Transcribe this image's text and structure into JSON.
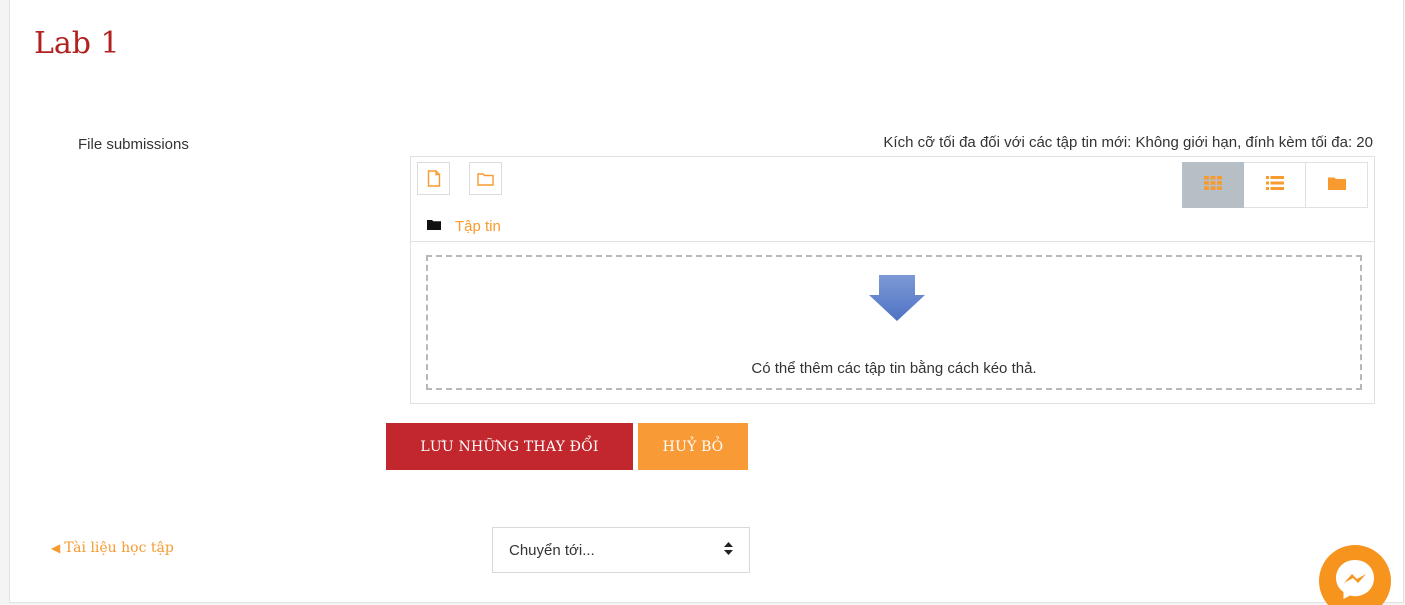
{
  "page": {
    "title": "Lab 1"
  },
  "submission": {
    "field_label": "File submissions",
    "limit_note": "Kích cỡ tối đa đối với các tập tin mới: Không giới hạn, đính kèm tối đa: 20"
  },
  "filemanager": {
    "toolbar": {
      "add_file_icon": "file-icon",
      "create_folder_icon": "folder-outline-icon"
    },
    "views": [
      {
        "name": "icons-view",
        "icon": "grid-icon",
        "active": true
      },
      {
        "name": "list-view",
        "icon": "list-icon",
        "active": false
      },
      {
        "name": "tree-view",
        "icon": "folder-icon",
        "active": false
      }
    ],
    "path_label": "Tập tin",
    "dropzone_text": "Có thể thêm các tập tin bằng cách kéo thả."
  },
  "actions": {
    "save_label": "LƯU NHỮNG THAY ĐỔI",
    "cancel_label": "HUỶ BỎ"
  },
  "navigation": {
    "prev_label": "Tài liệu học tập",
    "jump_placeholder": "Chuyển tới..."
  },
  "colors": {
    "title": "#b1211f",
    "save_button": "#c1272d",
    "cancel_button": "#f89a35",
    "link": "#f79a2f",
    "active_view": "#b6bec6",
    "messenger": "#f7941d"
  }
}
